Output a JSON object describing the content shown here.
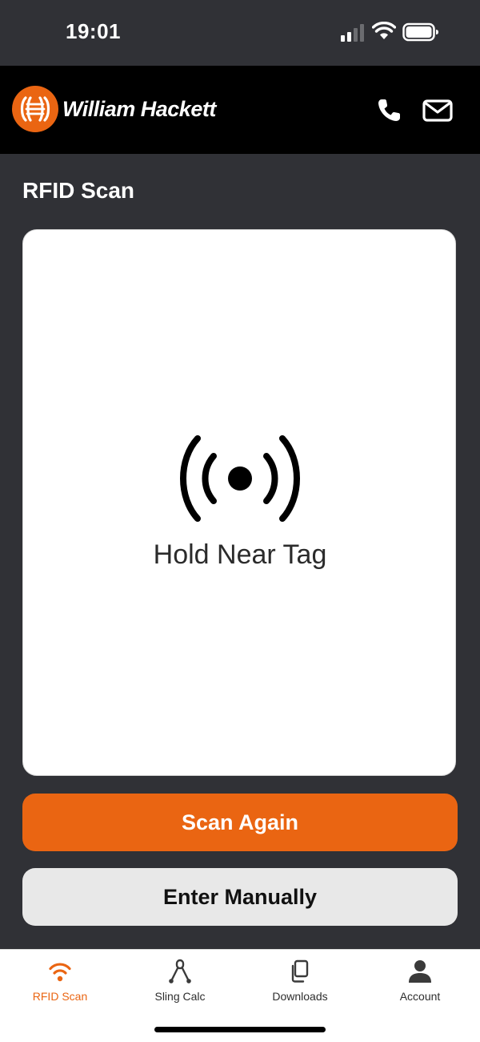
{
  "status_bar": {
    "time": "19:01",
    "icons": [
      "cellular-signal-icon",
      "wifi-icon",
      "battery-icon"
    ]
  },
  "header": {
    "brand": "William Hackett",
    "logo": "william-hackett-logo",
    "actions": [
      "phone-icon",
      "mail-icon"
    ]
  },
  "page": {
    "title": "RFID Scan"
  },
  "scan_card": {
    "icon": "rfid-broadcast-icon",
    "message": "Hold Near Tag"
  },
  "buttons": {
    "scan_again": "Scan Again",
    "enter_manually": "Enter Manually"
  },
  "tab_bar": {
    "items": [
      {
        "label": "RFID Scan",
        "icon": "rfid-icon",
        "active": true
      },
      {
        "label": "Sling Calc",
        "icon": "sling-icon",
        "active": false
      },
      {
        "label": "Downloads",
        "icon": "documents-icon",
        "active": false
      },
      {
        "label": "Account",
        "icon": "person-icon",
        "active": false
      }
    ]
  },
  "colors": {
    "accent": "#ea6512",
    "background": "#303136",
    "header": "#000000",
    "card": "#ffffff",
    "secondary_button": "#e8e8e8"
  }
}
